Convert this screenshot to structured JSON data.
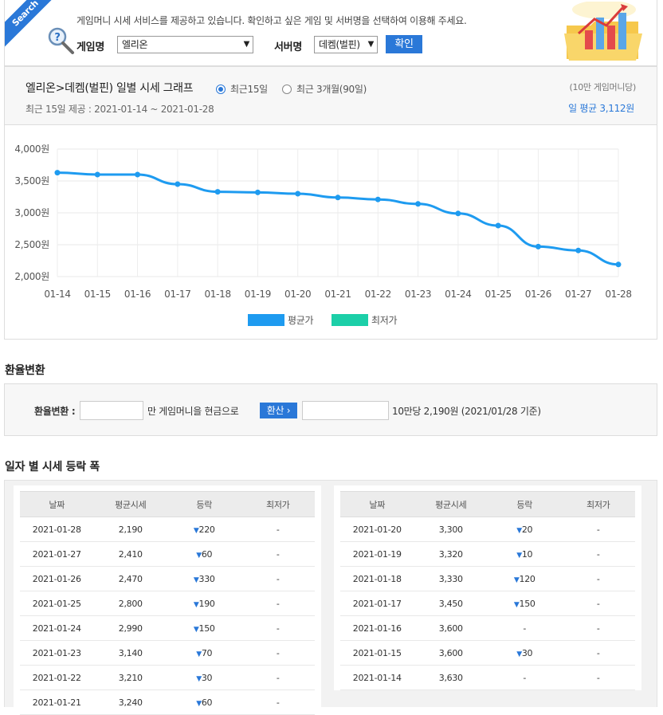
{
  "search": {
    "badge": "Search",
    "notice": "게임머니 시세 서비스를 제공하고 있습니다. 확인하고 싶은 게임 및 서버명을 선택하여 이용해 주세요.",
    "game_label": "게임명",
    "game_value": "엘리온",
    "server_label": "서버명",
    "server_value": "데켐(벌핀)",
    "confirm_label": "확인"
  },
  "graph": {
    "title": "엘리온>데켐(벌핀) 일별 시세 그래프",
    "radio_15": "최근15일",
    "radio_90": "최근 3개월(90일)",
    "period": "최근 15일 제공 : 2021-01-14 ~ 2021-01-28",
    "unit": "(10만 게임머니당)",
    "avg": "일 평균 3,112원"
  },
  "chart_data": {
    "type": "line",
    "categories": [
      "01-14",
      "01-15",
      "01-16",
      "01-17",
      "01-18",
      "01-19",
      "01-20",
      "01-21",
      "01-22",
      "01-23",
      "01-24",
      "01-25",
      "01-26",
      "01-27",
      "01-28"
    ],
    "series": [
      {
        "name": "평균가",
        "color": "#1e9bf0",
        "values": [
          3630,
          3600,
          3600,
          3450,
          3330,
          3320,
          3300,
          3240,
          3210,
          3140,
          2990,
          2800,
          2470,
          2410,
          2190
        ]
      },
      {
        "name": "최저가",
        "color": "#1ccfa8",
        "values": []
      }
    ],
    "yticks": [
      "4,000원",
      "3,500원",
      "3,000원",
      "2,500원",
      "2,000원"
    ],
    "ylim": [
      2000,
      4000
    ],
    "grid": true,
    "legend_position": "bottom"
  },
  "exchange": {
    "section_title": "환율변환",
    "label": "환율변환 :",
    "mid_text": "만 게임머니을 현금으로",
    "button": "환산",
    "rate_text": "10만당 2,190원 (2021/01/28 기준)"
  },
  "daily": {
    "section_title": "일자 별 시세 등락 폭",
    "headers": [
      "날짜",
      "평균시세",
      "등락",
      "최저가"
    ],
    "left_rows": [
      [
        "2021-01-28",
        "2,190",
        "220",
        "-"
      ],
      [
        "2021-01-27",
        "2,410",
        "60",
        "-"
      ],
      [
        "2021-01-26",
        "2,470",
        "330",
        "-"
      ],
      [
        "2021-01-25",
        "2,800",
        "190",
        "-"
      ],
      [
        "2021-01-24",
        "2,990",
        "150",
        "-"
      ],
      [
        "2021-01-23",
        "3,140",
        "70",
        "-"
      ],
      [
        "2021-01-22",
        "3,210",
        "30",
        "-"
      ],
      [
        "2021-01-21",
        "3,240",
        "60",
        "-"
      ]
    ],
    "right_rows": [
      [
        "2021-01-20",
        "3,300",
        "20",
        "-"
      ],
      [
        "2021-01-19",
        "3,320",
        "10",
        "-"
      ],
      [
        "2021-01-18",
        "3,330",
        "120",
        "-"
      ],
      [
        "2021-01-17",
        "3,450",
        "150",
        "-"
      ],
      [
        "2021-01-16",
        "3,600",
        "-",
        "-"
      ],
      [
        "2021-01-15",
        "3,600",
        "30",
        "-"
      ],
      [
        "2021-01-14",
        "3,630",
        "-",
        "-"
      ]
    ]
  }
}
